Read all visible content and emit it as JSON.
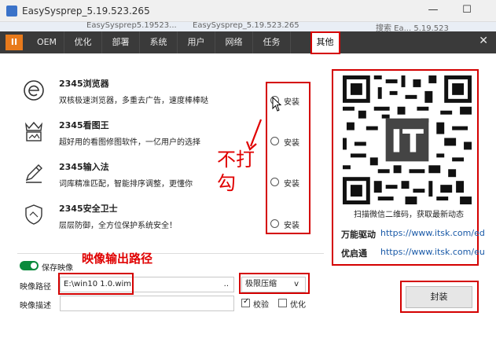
{
  "window": {
    "title": "EasySysprep_5.19.523.265",
    "minimize": "—",
    "maximize": "☐",
    "close": "✕"
  },
  "background_strip": {
    "left_text": "EasySysprep5.19523...",
    "mid_text": "EasySysprep_5.19.523.265",
    "right_text": "搜索 Ea...   5.19.523"
  },
  "tabs": {
    "pause_label": "II",
    "items": [
      "OEM",
      "优化",
      "部署",
      "系统",
      "用户",
      "网络",
      "任务",
      "其他"
    ],
    "active": "其他",
    "close_label": "✕"
  },
  "software": [
    {
      "name": "2345浏览器",
      "desc": "双核极速浏览器，多重去广告，速度棒棒哒",
      "install_label": "安装",
      "icon": "browser-e-icon"
    },
    {
      "name": "2345看图王",
      "desc": "超好用的看图修图软件，一亿用户的选择",
      "install_label": "安装",
      "icon": "crown-picture-icon"
    },
    {
      "name": "2345输入法",
      "desc": "词库精准匹配，智能排序调整，更懂你",
      "install_label": "安装",
      "icon": "pen-icon"
    },
    {
      "name": "2345安全卫士",
      "desc": "层层防御，全方位保护系统安全！",
      "install_label": "安装",
      "icon": "shield-icon"
    }
  ],
  "annotations": {
    "no_check_line1": "不打",
    "no_check_line2": "勾",
    "image_path_title": "映像输出路径"
  },
  "qr": {
    "logo_text": "IT",
    "caption": "扫描微信二维码，获取最新动态"
  },
  "links": [
    {
      "label": "万能驱动",
      "url": "https://www.itsk.com/ed"
    },
    {
      "label": "优启通",
      "url": "https://www.itsk.com/eu"
    }
  ],
  "image_options": {
    "save_image_label": "保存映像",
    "path_label": "映像路径",
    "path_value": "E:\\win10 1.0.wim",
    "browse_label": "..",
    "compress_value": "极限压缩",
    "desc_label": "映像描述",
    "desc_value": "",
    "verify_label": "校验",
    "optimize_label": "优化"
  },
  "seal_button": "封装",
  "colors": {
    "accent_orange": "#e87a1c",
    "annotation_red": "#d40000",
    "toggle_green": "#0a8a3c"
  }
}
